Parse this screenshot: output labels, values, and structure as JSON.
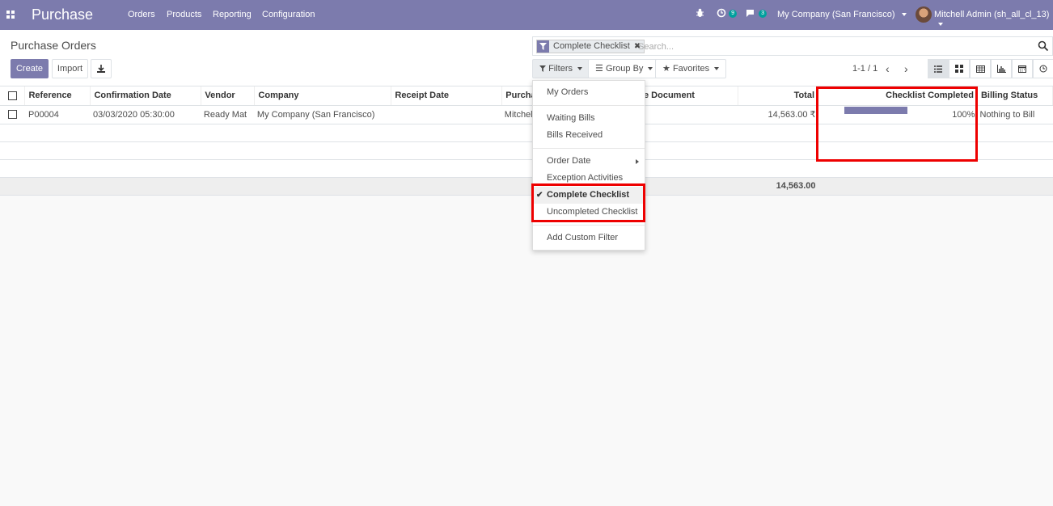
{
  "navbar": {
    "app_title": "Purchase",
    "menus": [
      "Orders",
      "Products",
      "Reporting",
      "Configuration"
    ],
    "activity_count": "9",
    "messages_count": "3",
    "company": "My Company (San Francisco)",
    "user": "Mitchell Admin (sh_all_cl_13)"
  },
  "control_panel": {
    "title": "Purchase Orders",
    "create_label": "Create",
    "import_label": "Import",
    "search_facet": "Complete Checklist",
    "search_placeholder": "Search...",
    "filters_label": "Filters",
    "groupby_label": "Group By",
    "favorites_label": "Favorites",
    "pager": "1-1 / 1"
  },
  "table": {
    "columns": [
      "Reference",
      "Confirmation Date",
      "Vendor",
      "Company",
      "Receipt Date",
      "Purchase Representative",
      "Source Document",
      "Total",
      "Checklist Completed",
      "Billing Status"
    ],
    "col_purchase_visible": "Purcha",
    "col_source_visible": "ource Document",
    "rows": [
      {
        "reference": "P00004",
        "confirmation_date": "03/03/2020 05:30:00",
        "vendor": "Ready Mat",
        "company": "My Company (San Francisco)",
        "receipt_date": "",
        "purchase_rep": "Mitchell",
        "source_document": "",
        "total": "14,563.00 ₹",
        "checklist_progress": 1.0,
        "checklist_label": "100%",
        "billing_status": "Nothing to Bill"
      }
    ],
    "footer_total": "14,563.00"
  },
  "filters_dropdown": {
    "items": [
      {
        "label": "My Orders",
        "group": 1
      },
      {
        "label": "Waiting Bills",
        "group": 2
      },
      {
        "label": "Bills Received",
        "group": 2
      },
      {
        "label": "Order Date",
        "group": 3,
        "submenu": true
      },
      {
        "label": "Exception Activities",
        "group": 3
      },
      {
        "label": "Complete Checklist",
        "group": 3,
        "selected": true
      },
      {
        "label": "Uncompleted Checklist",
        "group": 3
      },
      {
        "label": "Add Custom Filter",
        "group": 4
      }
    ]
  },
  "colors": {
    "brand": "#7c7bad",
    "highlight": "#e00000",
    "badge": "#00a09d"
  }
}
